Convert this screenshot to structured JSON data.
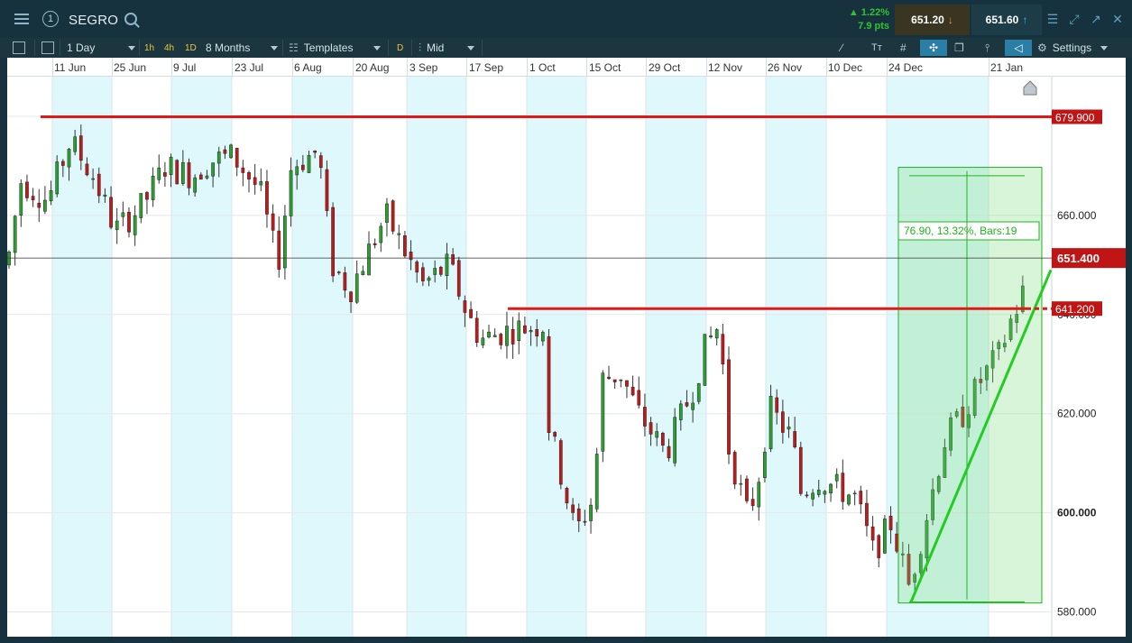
{
  "header": {
    "instrument": "SEGRO",
    "change_pct": "▲ 1.22%",
    "change_pts": "7.9 pts",
    "sell_price": "651.20",
    "buy_price": "651.60"
  },
  "toolbar": {
    "interval": "1 Day",
    "quick_intervals": [
      "1h",
      "4h",
      "1D"
    ],
    "range": "8 Months",
    "templates": "Templates",
    "d_label": "D",
    "price_type": "Mid",
    "settings": "Settings"
  },
  "chart_data": {
    "type": "candlestick",
    "x_labels": [
      "11 Jun",
      "25 Jun",
      "9 Jul",
      "23 Jul",
      "6 Aug",
      "20 Aug",
      "3 Sep",
      "17 Sep",
      "1 Oct",
      "15 Oct",
      "29 Oct",
      "12 Nov",
      "26 Nov",
      "10 Dec",
      "24 Dec",
      "21 Jan"
    ],
    "y_ticks": [
      "680.000",
      "660.000",
      "640.000",
      "620.000",
      "600.000",
      "580.000"
    ],
    "ylim": [
      575,
      688
    ],
    "current_price": "651.400",
    "resistance_1": "679.900",
    "resistance_2": "641.200",
    "measure_label": "76.90, 13.32%, Bars:19",
    "colors": {
      "up": "#2aa12e",
      "down": "#c21a1a",
      "level": "#e11818",
      "trend": "#22cc22",
      "shade": "#dff8fb"
    }
  }
}
